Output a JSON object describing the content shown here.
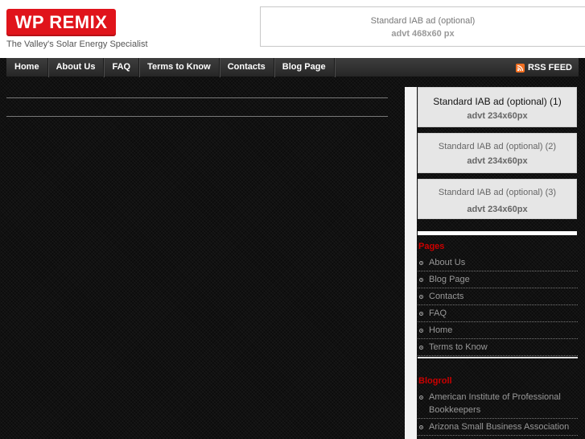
{
  "header": {
    "logo_text": "WP REMIX",
    "tagline": "The Valley's Solar Energy Specialist",
    "ad": {
      "title": "Standard IAB ad (optional)",
      "size": "advt 468x60 px"
    }
  },
  "nav": {
    "items": [
      {
        "label": "Home"
      },
      {
        "label": "About Us"
      },
      {
        "label": "FAQ"
      },
      {
        "label": "Terms to Know"
      },
      {
        "label": "Contacts"
      },
      {
        "label": "Blog Page"
      }
    ],
    "rss_label": "RSS FEED",
    "rss_icon": "rss-icon"
  },
  "sidebar": {
    "ads": [
      {
        "title": "Standard IAB ad (optional)  (1)",
        "size": "advt 234x60px"
      },
      {
        "title": "Standard IAB ad (optional) (2)",
        "size": "advt 234x60px"
      },
      {
        "title": "Standard IAB ad (optional) (3)",
        "size": "advt 234x60px"
      }
    ],
    "pages": {
      "title": "Pages",
      "items": [
        "About Us",
        "Blog Page",
        "Contacts",
        "FAQ",
        "Home",
        "Terms to Know"
      ]
    },
    "blogroll": {
      "title": "Blogroll",
      "items": [
        "American Institute of Professional Bookkeepers",
        "Arizona Small Business Association"
      ]
    }
  },
  "colors": {
    "accent": "#e0141b",
    "widget_title": "#cc0000",
    "rss": "#f26f21",
    "background": "#111111"
  }
}
